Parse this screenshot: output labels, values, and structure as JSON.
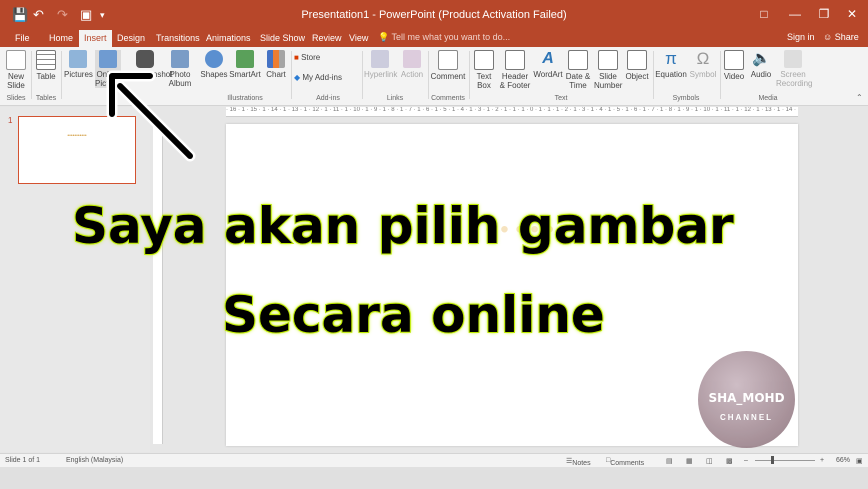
{
  "title": "Presentation1 - PowerPoint (Product Activation Failed)",
  "tabs": [
    "File",
    "Home",
    "Insert",
    "Design",
    "Transitions",
    "Animations",
    "Slide Show",
    "Review",
    "View"
  ],
  "active_tab": "Insert",
  "tell_me": "Tell me what you want to do...",
  "sign_in": "Sign in",
  "share": "Share",
  "ribbon": {
    "new_slide": "New Slide",
    "table": "Table",
    "pictures": "Pictures",
    "online_pictures": "Online Pictures",
    "screenshot": "Screenshot",
    "photo_album": "Photo Album",
    "shapes": "Shapes",
    "smartart": "SmartArt",
    "chart": "Chart",
    "store": "Store",
    "my_addins": "My Add-ins",
    "hyperlink": "Hyperlink",
    "action": "Action",
    "comment": "Comment",
    "text_box": "Text Box",
    "header_footer": "Header & Footer",
    "wordart": "WordArt",
    "date_time": "Date & Time",
    "slide_number": "Slide Number",
    "object": "Object",
    "equation": "Equation",
    "symbol": "Symbol",
    "video": "Video",
    "audio": "Audio",
    "screen_recording": "Screen Recording"
  },
  "groups": {
    "slides": "Slides",
    "tables": "Tables",
    "illustrations": "Illustrations",
    "addins": "Add-ins",
    "links": "Links",
    "comments": "Comments",
    "text": "Text",
    "symbols": "Symbols",
    "media": "Media"
  },
  "ruler_text": "· 16 · 1 · 15 · 1 · 14 · 1 · 13 · 1 · 12 · 1 · 11 · 1 · 10 · 1 · 9 · 1 · 8 · 1 · 7 · 1 · 6 · 1 · 5 · 1 · 4 · 1 · 3 · 1 · 2 · 1 · 1 · 1 · 0 · 1 · 1 · 1 · 2 · 1 · 3 · 1 · 4 · 1 · 5 · 1 · 6 · 1 · 7 · 1 · 8 · 1 · 9 · 1 · 10 · 1 · 11 · 1 · 12 · 1 · 13 · 1 · 14 · 1 · 15 · 1 · 16 ·",
  "slide_thumb_number": "1",
  "caption_line1": "Saya akan pilih gambar",
  "caption_line2": "Secara online",
  "watermark_name": "SHA_MOHD",
  "watermark_sub": "CHANNEL",
  "status": {
    "slide_of": "Slide 1 of 1",
    "language": "English (Malaysia)",
    "notes": "Notes",
    "comments": "Comments",
    "zoom": "66%"
  },
  "colors": {
    "accent": "#b7472a",
    "caption_outline": "#b6e000"
  },
  "icons": [
    "save-icon",
    "undo-icon",
    "redo-icon",
    "start-presentation-icon",
    "customize-icon",
    "user-icon",
    "arrow-pointer-icon"
  ]
}
